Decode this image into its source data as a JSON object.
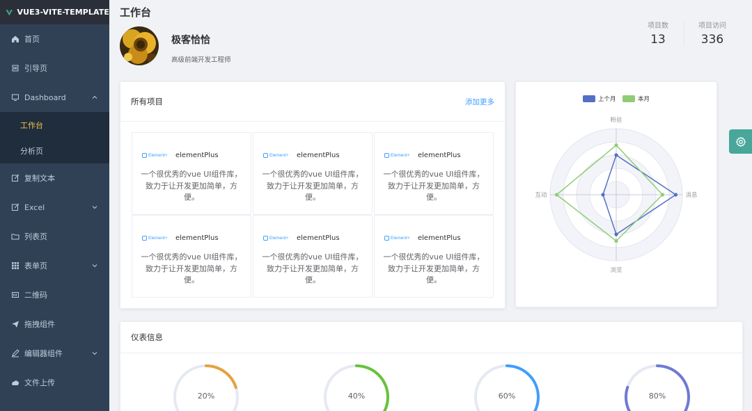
{
  "sidebar": {
    "logo_text": "VUE3-VITE-TEMPLATE",
    "items": [
      {
        "label": "首页",
        "icon": "home-icon"
      },
      {
        "label": "引导页",
        "icon": "guide-icon"
      },
      {
        "label": "Dashboard",
        "icon": "dashboard-icon",
        "expanded": true
      },
      {
        "label": "工作台",
        "active": true
      },
      {
        "label": "分析页"
      },
      {
        "label": "复制文本",
        "icon": "edit-icon"
      },
      {
        "label": "Excel",
        "icon": "edit-icon"
      },
      {
        "label": "列表页",
        "icon": "folder-icon"
      },
      {
        "label": "表单页",
        "icon": "grid-icon"
      },
      {
        "label": "二维码",
        "icon": "qrcode-icon"
      },
      {
        "label": "拖拽组件",
        "icon": "send-icon"
      },
      {
        "label": "编辑器组件",
        "icon": "pen-icon"
      },
      {
        "label": "文件上传",
        "icon": "cloud-upload-icon"
      }
    ]
  },
  "page": {
    "title": "工作台"
  },
  "profile": {
    "name": "极客恰恰",
    "title": "高级前端开发工程师"
  },
  "stats": [
    {
      "label": "项目数",
      "value": "13"
    },
    {
      "label": "项目访问",
      "value": "336"
    }
  ],
  "projects": {
    "title": "所有项目",
    "more_link": "添加更多",
    "logo_text": "Element+",
    "items": [
      {
        "name": "elementPlus",
        "desc": "一个很优秀的vue UI组件库，致力于让开发更加简单，方便。"
      },
      {
        "name": "elementPlus",
        "desc": "一个很优秀的vue UI组件库，致力于让开发更加简单，方便。"
      },
      {
        "name": "elementPlus",
        "desc": "一个很优秀的vue UI组件库，致力于让开发更加简单，方便。"
      },
      {
        "name": "elementPlus",
        "desc": "一个很优秀的vue UI组件库，致力于让开发更加简单，方便。"
      },
      {
        "name": "elementPlus",
        "desc": "一个很优秀的vue UI组件库，致力于让开发更加简单，方便。"
      },
      {
        "name": "elementPlus",
        "desc": "一个很优秀的vue UI组件库，致力于让开发更加简单，方便。"
      }
    ]
  },
  "chart_data": {
    "type": "radar",
    "indicators": [
      "粉丝",
      "消息",
      "浏览",
      "互动"
    ],
    "max": 100,
    "series": [
      {
        "name": "上个月",
        "color": "#5470c6",
        "values": [
          60,
          90,
          60,
          20
        ]
      },
      {
        "name": "本月",
        "color": "#91cc75",
        "values": [
          75,
          70,
          70,
          90
        ]
      }
    ]
  },
  "meters": {
    "title": "仪表信息",
    "items": [
      {
        "label": "20%",
        "value": 20,
        "color": "#e6a23c"
      },
      {
        "label": "40%",
        "value": 40,
        "color": "#67c23a"
      },
      {
        "label": "60%",
        "value": 60,
        "color": "#409eff"
      },
      {
        "label": "80%",
        "value": 80,
        "color": "#6f7ad3"
      }
    ]
  },
  "colors": {
    "sidebar_bg": "#304156",
    "submenu_bg": "#1f2d3d",
    "active_text": "#f4c341",
    "accent": "#409eff",
    "settings_button": "#48a79a"
  }
}
